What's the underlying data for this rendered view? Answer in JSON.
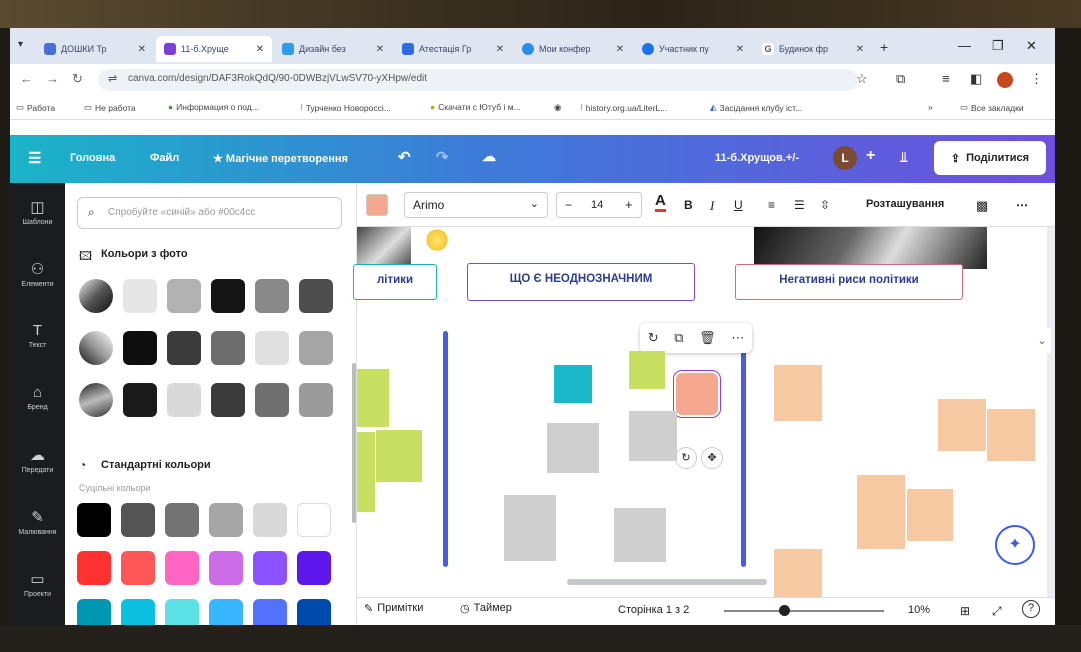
{
  "browser": {
    "tabs": [
      {
        "label": "ДОШКИ Тр",
        "color": "#4a6fd6"
      },
      {
        "label": "11-б.Хруще",
        "color": "#7b3fd8"
      },
      {
        "label": "Дизайн без",
        "color": "#2f9be6"
      },
      {
        "label": "Атестація Гр",
        "color": "#2f6be6"
      },
      {
        "label": "Мои конфер",
        "color": "#2a8cf0"
      },
      {
        "label": "Участник пу",
        "color": "#1a73e8"
      },
      {
        "label": "Будинок фр",
        "color": "#888888"
      }
    ],
    "url": "canva.com/design/DAF3RokQdQ/90-0DWBzjVLwSV70-yXHpw/edit",
    "bookmarks": [
      "Работа",
      "Не работа",
      "Информация о под...",
      "Турченко Новороссі...",
      "Скачати с Ютуб і м...",
      "history.org.ua/LiterL...",
      "Засідання клубу іст...",
      "Все закладки"
    ]
  },
  "toolbar": {
    "home": "Головна",
    "file": "Файл",
    "magic": "★ Магічне перетворення",
    "doc_title": "11-б.Хрущов.+/-",
    "avatar_letter": "L",
    "share": "Поділитися"
  },
  "sidebar": [
    {
      "label": "Шаблони",
      "icon": "templates-icon",
      "glyph": "◫"
    },
    {
      "label": "Елементи",
      "icon": "elements-icon",
      "glyph": "⚇"
    },
    {
      "label": "Текст",
      "icon": "text-icon",
      "glyph": "T"
    },
    {
      "label": "Бренд",
      "icon": "brand-icon",
      "glyph": "⌂"
    },
    {
      "label": "Передати",
      "icon": "upload-icon",
      "glyph": "☁"
    },
    {
      "label": "Малювання",
      "icon": "draw-icon",
      "glyph": "✎"
    },
    {
      "label": "Проекти",
      "icon": "projects-icon",
      "glyph": "▭"
    }
  ],
  "panel": {
    "search_placeholder": "Спробуйте «синій» або #00c4cc",
    "photo_colors_title": "Кольори з фото",
    "standard_colors_title": "Стандартні кольори",
    "solid_label": "Суцільні кольори",
    "photo_rows": [
      [
        "#e6e6e6",
        "#b2b2b2",
        "#151515",
        "#8a8a8a",
        "#4e4e4e"
      ],
      [
        "#0e0e0e",
        "#3b3b3b",
        "#6e6e6e",
        "#e0e0e0",
        "#a6a6a6"
      ],
      [
        "#1a1a1a",
        "#d8d8d8",
        "#3a3a3a",
        "#707070",
        "#9a9a9a"
      ]
    ],
    "standard_rows": [
      [
        "#000000",
        "#545454",
        "#737373",
        "#a6a6a6",
        "#d9d9d9",
        "#ffffff"
      ],
      [
        "#ff3131",
        "#ff5757",
        "#ff66c4",
        "#cb6ce6",
        "#8c52ff",
        "#5e17eb"
      ],
      [
        "#0097b2",
        "#0cc0df",
        "#5ce1e6",
        "#38b6ff",
        "#5271ff",
        "#004aad"
      ]
    ]
  },
  "properties": {
    "swatch_color": "#f4a98e",
    "font": "Arimo",
    "font_size": "14",
    "arrange": "Розташування"
  },
  "canvas": {
    "header_left": "літики",
    "header_center": "ЩО Є НЕОДНОЗНАЧНИМ",
    "header_right": "Негативні риси політики"
  },
  "bottom": {
    "notes": "Примітки",
    "timer": "Таймер",
    "page": "Сторінка 1 з 2",
    "zoom": "10%"
  }
}
